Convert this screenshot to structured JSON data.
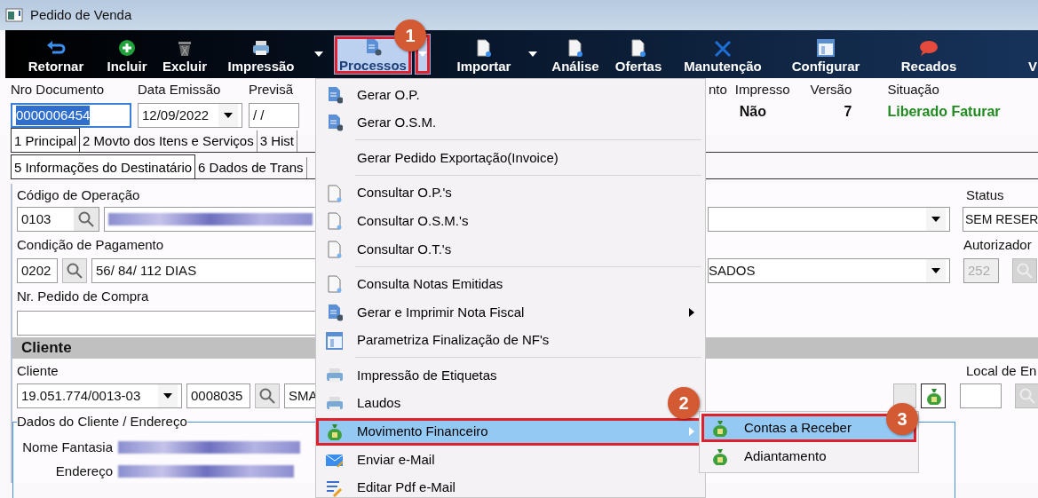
{
  "window": {
    "title": "Pedido de Venda"
  },
  "toolbar": [
    {
      "kind": "button",
      "label": "Retornar",
      "selected": false
    },
    {
      "kind": "button",
      "label": "Incluir",
      "selected": false
    },
    {
      "kind": "button",
      "label": "Excluir",
      "selected": false
    },
    {
      "kind": "button",
      "label": "Impressão",
      "selected": false
    },
    {
      "kind": "arrow"
    },
    {
      "kind": "button",
      "label": "Processos",
      "selected": true,
      "annotated": true
    },
    {
      "kind": "split",
      "selected": true,
      "annotated": true
    },
    {
      "kind": "button",
      "label": "Importar",
      "selected": false
    },
    {
      "kind": "arrow"
    },
    {
      "kind": "button",
      "label": "Análise",
      "selected": false
    },
    {
      "kind": "button",
      "label": "Ofertas",
      "selected": false
    },
    {
      "kind": "button",
      "label": "Manutenção",
      "selected": false
    },
    {
      "kind": "button",
      "label": "Configurar",
      "selected": false
    },
    {
      "kind": "button",
      "label": "Recados",
      "selected": false
    },
    {
      "kind": "button",
      "label": "V",
      "selected": false
    }
  ],
  "header": {
    "fields": [
      {
        "label": "Nro Documento",
        "value": "0000006454",
        "selected": true,
        "kind": "text"
      },
      {
        "label": "Data Emissão",
        "value": "12/09/2022",
        "selected": false,
        "kind": "date"
      },
      {
        "label": "Previsã",
        "value": "/ /",
        "selected": false,
        "kind": "text"
      }
    ],
    "info": [
      {
        "label": "nto"
      },
      {
        "label": "Impresso",
        "value": "Não",
        "kind": "plain"
      },
      {
        "label": "Versão",
        "value": "7",
        "kind": "number"
      },
      {
        "label": "Situação",
        "value": "Liberado Faturar",
        "kind": "status"
      }
    ]
  },
  "tabs": [
    {
      "label": "1 Principal",
      "selected": true
    },
    {
      "label": "2 Movto dos Itens e Serviços",
      "selected": false
    },
    {
      "label": "3 Hist",
      "selected": false
    }
  ],
  "subtabs": [
    {
      "label": "5 Informações do Destinatário",
      "selected": true
    },
    {
      "label": "6 Dados de Trans",
      "selected": false
    }
  ],
  "form": {
    "operacao": {
      "label": "Código de Operação",
      "code": "0103"
    },
    "status": {
      "label": "Status",
      "value": "SEM RESER"
    },
    "pagamento": {
      "label": "Condição de Pagamento",
      "code": "0202",
      "description": "56/ 84/ 112 DIAS",
      "combo": "SADOS"
    },
    "autorizador": {
      "label": "Autorizador",
      "value": "252",
      "disabled": true
    },
    "pedido_compra": {
      "label": "Nr. Pedido de Compra"
    }
  },
  "cliente": {
    "title": "Cliente",
    "label": "Cliente",
    "document": "19.051.774/0013-03",
    "code": "0008035",
    "name": "SMA",
    "local_label": "Local de En"
  },
  "dados": {
    "title": "Dados do Cliente / Endereço",
    "fields": [
      {
        "label": "Nome Fantasia"
      },
      {
        "label": "Endereço"
      }
    ]
  },
  "menu": [
    {
      "kind": "item",
      "label": "Gerar O.P.",
      "submenu": false,
      "selected": false
    },
    {
      "kind": "item",
      "label": "Gerar O.S.M.",
      "submenu": false,
      "selected": false
    },
    {
      "kind": "separator"
    },
    {
      "kind": "item",
      "label": "Gerar Pedido Exportação(Invoice)",
      "submenu": false,
      "selected": false
    },
    {
      "kind": "separator"
    },
    {
      "kind": "item",
      "label": "Consultar O.P.'s",
      "submenu": false,
      "selected": false
    },
    {
      "kind": "item",
      "label": "Consultar O.S.M.'s",
      "submenu": false,
      "selected": false
    },
    {
      "kind": "item",
      "label": "Consultar O.T.'s",
      "submenu": false,
      "selected": false
    },
    {
      "kind": "separator"
    },
    {
      "kind": "item",
      "label": "Consulta Notas Emitidas",
      "submenu": false,
      "selected": false
    },
    {
      "kind": "item",
      "label": "Gerar e Imprimir Nota Fiscal",
      "submenu": true,
      "selected": false
    },
    {
      "kind": "item",
      "label": "Parametriza Finalização de NF's",
      "submenu": false,
      "selected": false
    },
    {
      "kind": "separator"
    },
    {
      "kind": "item",
      "label": "Impressão de Etiquetas",
      "submenu": false,
      "selected": false
    },
    {
      "kind": "item",
      "label": "Laudos",
      "submenu": false,
      "selected": false
    },
    {
      "kind": "item",
      "label": "Movimento Financeiro",
      "submenu": true,
      "selected": true,
      "annotated": true
    },
    {
      "kind": "item",
      "label": "Enviar e-Mail",
      "submenu": false,
      "selected": false
    },
    {
      "kind": "item",
      "label": "Editar Pdf e-Mail",
      "submenu": false,
      "selected": false
    }
  ],
  "submenu": [
    {
      "label": "Contas a Receber",
      "selected": true,
      "annotated": true
    },
    {
      "label": "Adiantamento",
      "selected": false
    }
  ],
  "callouts": [
    "1",
    "2",
    "3"
  ]
}
